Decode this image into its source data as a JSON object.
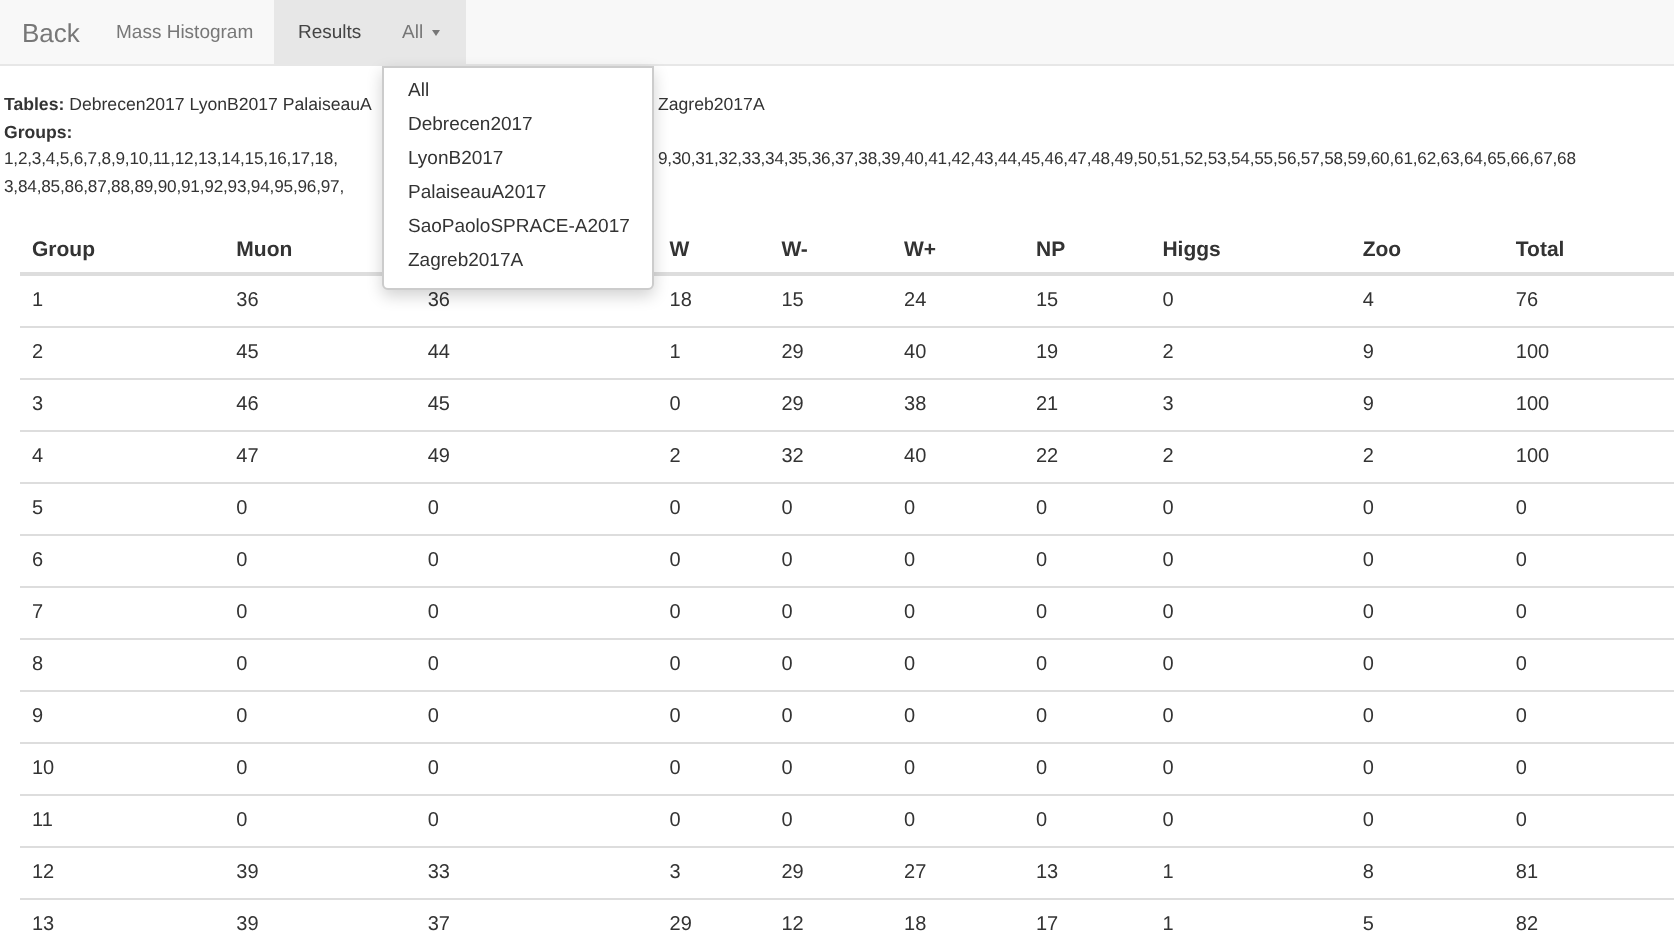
{
  "nav": {
    "brand": "Back",
    "items": [
      {
        "label": "Mass Histogram",
        "selected": false,
        "kind": "link"
      },
      {
        "label": "Results",
        "selected": true,
        "kind": "link"
      },
      {
        "label": "All",
        "selected": false,
        "kind": "dropdown",
        "expanded": true
      }
    ]
  },
  "dropdown": {
    "items": [
      "All",
      "Debrecen2017",
      "LyonB2017",
      "PalaiseauA2017",
      "SaoPaoloSPRACE-A2017",
      "Zagreb2017A"
    ]
  },
  "info": {
    "tables_label": "Tables:",
    "tables_left": "Debrecen2017 LyonB2017 PalaiseauA",
    "tables_right": "Zagreb2017A",
    "groups_label": "Groups:",
    "groups_lines": [
      [
        "1,2,3,4,5,6,7,8,9,10,11,12,13,14,15,16,17,18,",
        "9,30,31,32,33,34,35,36,37,38,39,40,41,42,43,44,45,46,47,48,49,50,51,52,53,54,55,56,57,58,59,60,61,62,63,64,65,66,67,68"
      ],
      [
        "3,84,85,86,87,88,89,90,91,92,93,94,95,96,97,"
      ]
    ]
  },
  "table": {
    "columns": [
      {
        "label": "Group"
      },
      {
        "label": "Muon"
      },
      {},
      {
        "label": "W"
      },
      {
        "label": "W-"
      },
      {
        "label": "W+"
      },
      {
        "label": "NP"
      },
      {
        "label": "Higgs"
      },
      {
        "label": "Zoo"
      },
      {
        "label": "Total"
      }
    ],
    "rows": [
      [
        "1",
        "36",
        "36",
        "18",
        "15",
        "24",
        "15",
        "0",
        "4",
        "76"
      ],
      [
        "2",
        "45",
        "44",
        "1",
        "29",
        "40",
        "19",
        "2",
        "9",
        "100"
      ],
      [
        "3",
        "46",
        "45",
        "0",
        "29",
        "38",
        "21",
        "3",
        "9",
        "100"
      ],
      [
        "4",
        "47",
        "49",
        "2",
        "32",
        "40",
        "22",
        "2",
        "2",
        "100"
      ],
      [
        "5",
        "0",
        "0",
        "0",
        "0",
        "0",
        "0",
        "0",
        "0",
        "0"
      ],
      [
        "6",
        "0",
        "0",
        "0",
        "0",
        "0",
        "0",
        "0",
        "0",
        "0"
      ],
      [
        "7",
        "0",
        "0",
        "0",
        "0",
        "0",
        "0",
        "0",
        "0",
        "0"
      ],
      [
        "8",
        "0",
        "0",
        "0",
        "0",
        "0",
        "0",
        "0",
        "0",
        "0"
      ],
      [
        "9",
        "0",
        "0",
        "0",
        "0",
        "0",
        "0",
        "0",
        "0",
        "0"
      ],
      [
        "10",
        "0",
        "0",
        "0",
        "0",
        "0",
        "0",
        "0",
        "0",
        "0"
      ],
      [
        "11",
        "0",
        "0",
        "0",
        "0",
        "0",
        "0",
        "0",
        "0",
        "0"
      ],
      [
        "12",
        "39",
        "33",
        "3",
        "29",
        "27",
        "13",
        "1",
        "8",
        "81"
      ],
      [
        "13",
        "39",
        "37",
        "29",
        "12",
        "18",
        "17",
        "1",
        "5",
        "82"
      ]
    ]
  }
}
